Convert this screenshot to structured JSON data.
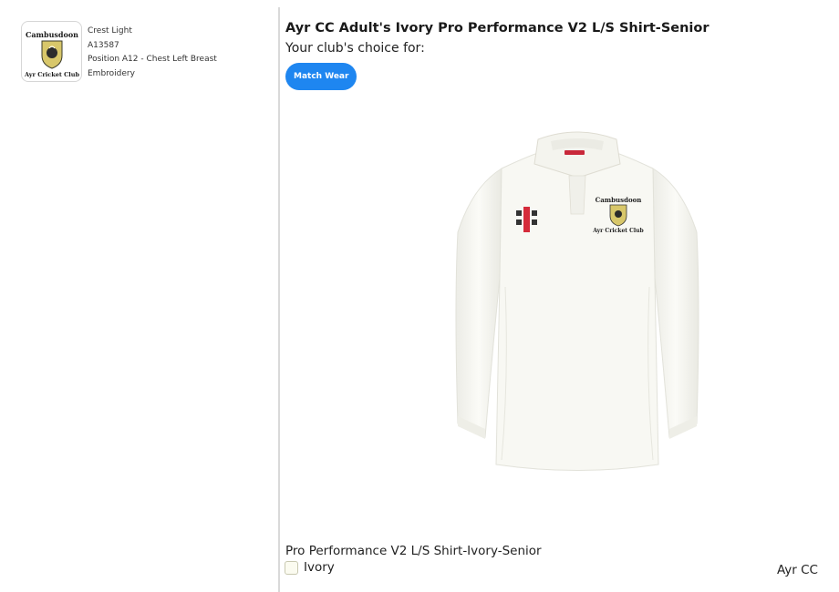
{
  "crest": {
    "name": "Crest Light",
    "code": "A13587",
    "position": "Position A12 - Chest Left Breast",
    "method": "Embroidery",
    "logo_text_top": "Cambusdoon",
    "logo_text_bottom": "Ayr Cricket Club"
  },
  "product": {
    "title": "Ayr CC Adult's Ivory Pro Performance V2 L/S Shirt-Senior",
    "club_choice_label": "Your club's choice for:",
    "tags": [
      "Match Wear"
    ],
    "variant_name": "Pro Performance V2 L/S Shirt-Ivory-Senior",
    "color_option": "Ivory",
    "club_name": "Ayr CC"
  },
  "colors": {
    "accent": "#1e86f0",
    "shirt": "#f7f7f2",
    "divider": "#d9d9d9"
  }
}
